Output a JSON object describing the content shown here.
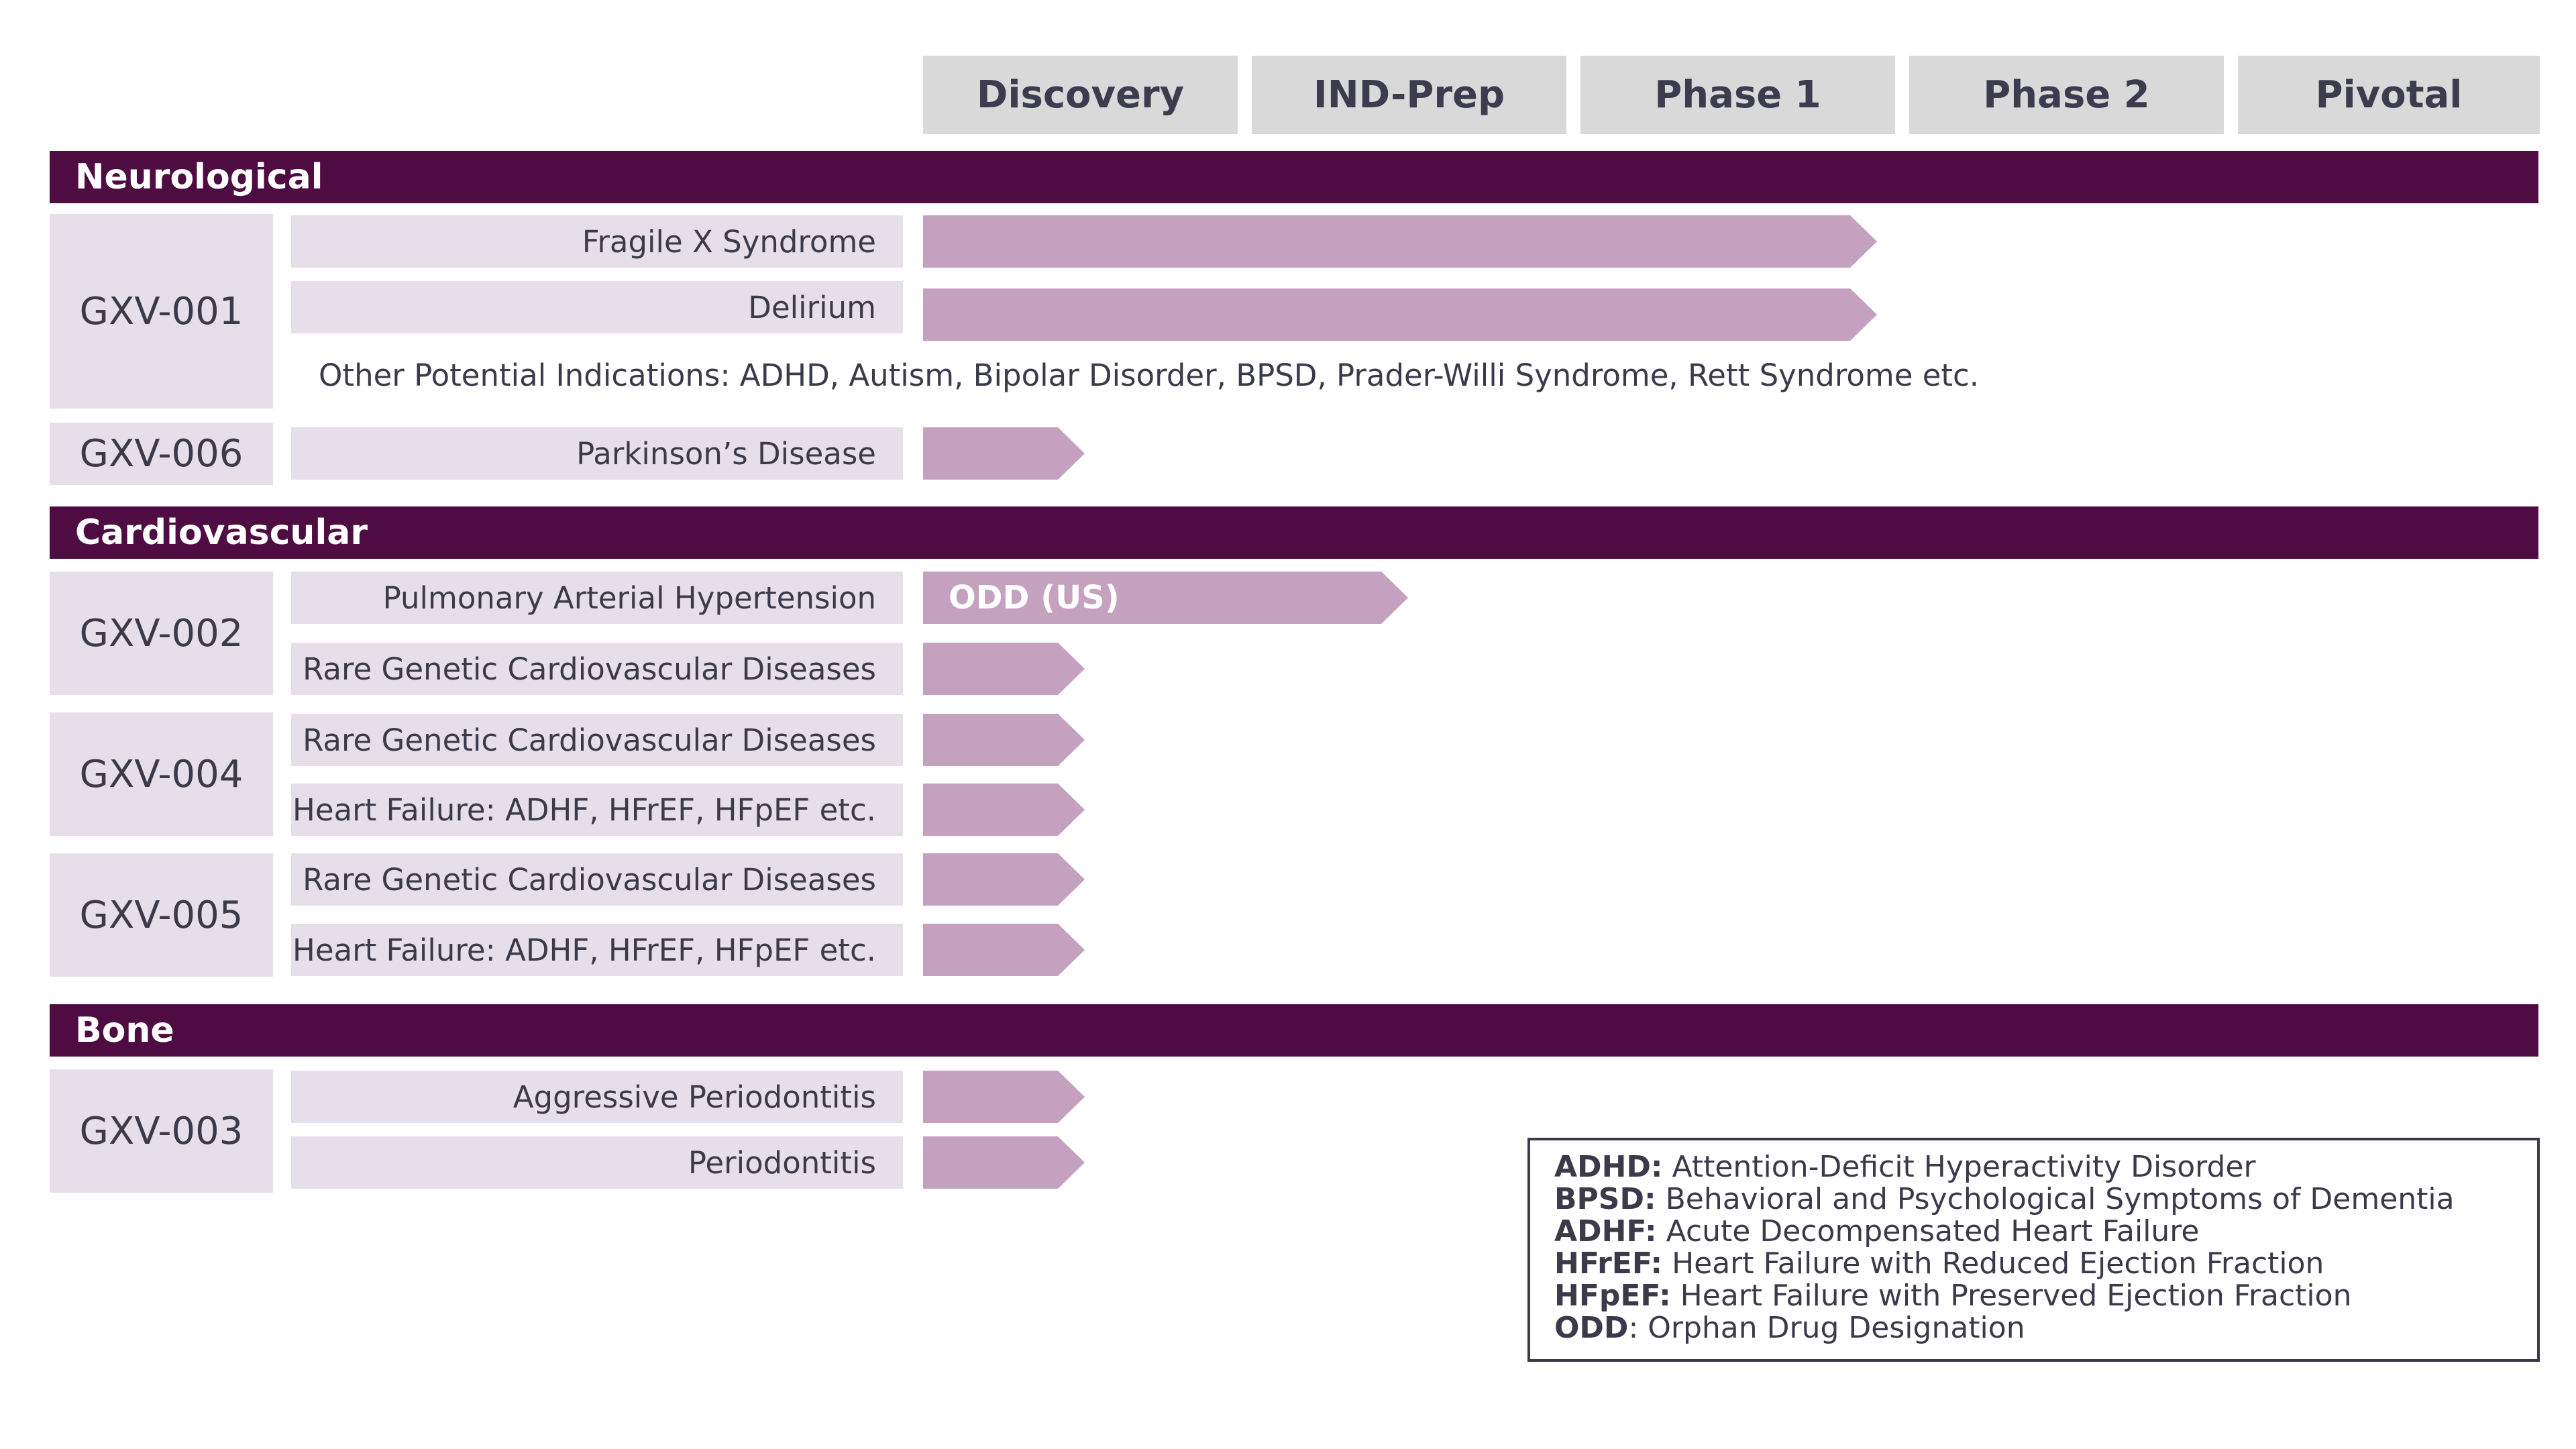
{
  "phases": [
    "Discovery",
    "IND-Prep",
    "Phase 1",
    "Phase 2",
    "Pivotal"
  ],
  "sections": {
    "neurological": "Neurological",
    "cardiovascular": "Cardiovascular",
    "bone": "Bone"
  },
  "programs": {
    "gxv001": {
      "name": "GXV-001",
      "indications": [
        {
          "label": "Fragile X Syndrome",
          "stage_progress": 0.59
        },
        {
          "label": "Delirium",
          "stage_progress": 0.59
        }
      ],
      "note": "Other Potential Indications: ADHD, Autism, Bipolar Disorder, BPSD, Prader-Willi Syndrome, Rett Syndrome etc."
    },
    "gxv006": {
      "name": "GXV-006",
      "indications": [
        {
          "label": "Parkinson’s Disease",
          "stage_progress": 0.1
        }
      ]
    },
    "gxv002": {
      "name": "GXV-002",
      "indications": [
        {
          "label": "Pulmonary Arterial Hypertension",
          "stage_progress": 0.3,
          "badge": "ODD (US)"
        },
        {
          "label": "Rare Genetic Cardiovascular Diseases",
          "stage_progress": 0.1
        }
      ]
    },
    "gxv004": {
      "name": "GXV-004",
      "indications": [
        {
          "label": "Rare Genetic Cardiovascular Diseases",
          "stage_progress": 0.1
        },
        {
          "label": "Heart Failure: ADHF, HFrEF, HFpEF etc.",
          "stage_progress": 0.1
        }
      ]
    },
    "gxv005": {
      "name": "GXV-005",
      "indications": [
        {
          "label": "Rare Genetic Cardiovascular Diseases",
          "stage_progress": 0.1
        },
        {
          "label": "Heart Failure: ADHF, HFrEF, HFpEF etc.",
          "stage_progress": 0.1
        }
      ]
    },
    "gxv003": {
      "name": "GXV-003",
      "indications": [
        {
          "label": "Aggressive Periodontitis",
          "stage_progress": 0.1
        },
        {
          "label": "Periodontitis",
          "stage_progress": 0.1
        }
      ]
    }
  },
  "legend": [
    {
      "abbr": "ADHD:",
      "text": " Attention-Deficit Hyperactivity Disorder"
    },
    {
      "abbr": "BPSD:",
      "text": " Behavioral and Psychological Symptoms of Dementia"
    },
    {
      "abbr": "ADHF:",
      "text": " Acute Decompensated Heart Failure"
    },
    {
      "abbr": "HFrEF:",
      "text": " Heart Failure with Reduced Ejection Fraction"
    },
    {
      "abbr": "HFpEF:",
      "text": " Heart Failure with Preserved Ejection Fraction"
    },
    {
      "abbr": "ODD",
      "text": ": Orphan Drug Designation"
    }
  ],
  "colors": {
    "section_bar": "#4e0c42",
    "arrow": "#c4a1bf",
    "label_box": "#e6dfea",
    "phase_header": "#d9d9d9"
  }
}
